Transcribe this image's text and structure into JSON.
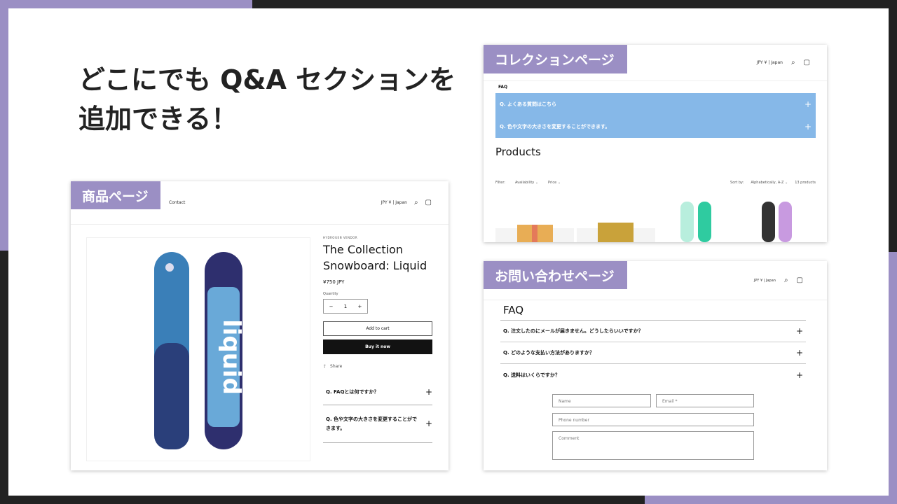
{
  "colors": {
    "accent": "#9b8fc4",
    "frame": "#222222",
    "faq_bg": "#86b8e8"
  },
  "headline": {
    "line1": "どこにでも Q&A セクションを",
    "line2": "追加できる！"
  },
  "product_page": {
    "tag": "商品ページ",
    "nav_contact": "Contact",
    "currency": "JPY ¥ | Japan",
    "vendor": "HYDROGEN VENDOR",
    "title_line1": "The Collection",
    "title_line2": "Snowboard: Liquid",
    "price": "¥750 JPY",
    "quantity_label": "Quantity",
    "quantity": "1",
    "minus": "−",
    "plus": "+",
    "add_to_cart": "Add to cart",
    "buy_now": "Buy it now",
    "share": "Share",
    "faq": [
      "Q. FAQとは何ですか？",
      "Q. 色や文字の大きさを変更することができます。"
    ]
  },
  "collection_page": {
    "tag": "コレクションページ",
    "currency": "JPY ¥ | Japan",
    "faq_heading": "FAQ",
    "faq": [
      "Q. よくある質問はこちら",
      "Q. 色や文字の大きさを変更することができます。"
    ],
    "products_heading": "Products",
    "filter_label": "Filter:",
    "filter_availability": "Availability",
    "filter_price": "Price",
    "sort_label": "Sort by:",
    "sort_value": "Alphabetically, A-Z",
    "count": "13 products"
  },
  "contact_page": {
    "tag": "お問い合わせページ",
    "currency": "JPY ¥ | Japan",
    "faq_heading": "FAQ",
    "faq": [
      "Q. 注文したのにメールが届きません。どうしたらいいですか？",
      "Q. どのような支払い方法がありますか？",
      "Q. 送料はいくらですか？"
    ],
    "name_placeholder": "Name",
    "email_placeholder": "Email *",
    "phone_placeholder": "Phone number",
    "comment_placeholder": "Comment"
  }
}
